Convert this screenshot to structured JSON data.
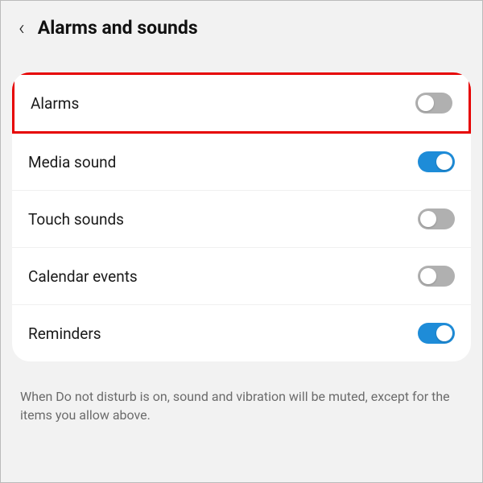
{
  "header": {
    "title": "Alarms and sounds"
  },
  "settings": {
    "items": [
      {
        "label": "Alarms",
        "on": false,
        "highlighted": true
      },
      {
        "label": "Media sound",
        "on": true,
        "highlighted": false
      },
      {
        "label": "Touch sounds",
        "on": false,
        "highlighted": false
      },
      {
        "label": "Calendar events",
        "on": false,
        "highlighted": false
      },
      {
        "label": "Reminders",
        "on": true,
        "highlighted": false
      }
    ]
  },
  "footer": {
    "note": "When Do not disturb is on, sound and vibration will be muted, except for the items you allow above."
  }
}
